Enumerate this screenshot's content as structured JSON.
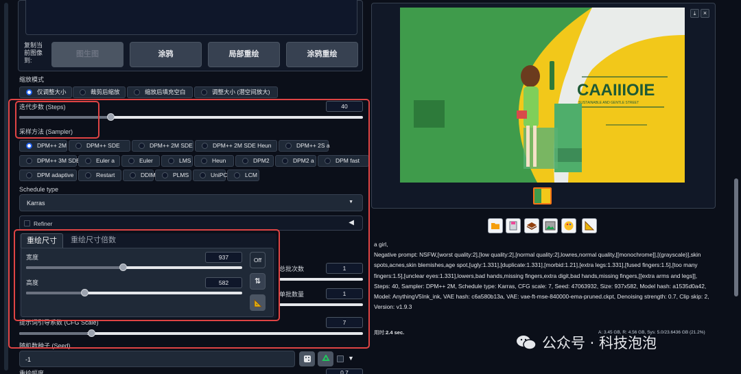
{
  "copy_to": {
    "label_lines": [
      "复制当",
      "前图像",
      "到:"
    ],
    "buttons": [
      "图生图",
      "涂鸦",
      "局部重绘",
      "涂鸦重绘"
    ]
  },
  "resize_mode": {
    "label": "缩放模式",
    "options": [
      "仅调整大小",
      "裁剪后缩放",
      "缩放后填充空白",
      "调整大小 (潜空间放大)"
    ],
    "selected": 0
  },
  "steps": {
    "label": "迭代步数 (Steps)",
    "value": "40",
    "min": 1,
    "max": 150,
    "raw": 40
  },
  "sampler": {
    "label": "采样方法 (Sampler)",
    "selected": "DPM++ 2M",
    "options": [
      "DPM++ 2M",
      "DPM++ SDE",
      "DPM++ 2M SDE",
      "DPM++ 2M SDE Heun",
      "DPM++ 2S a",
      "DPM++ 3M SDE",
      "Euler a",
      "Euler",
      "LMS",
      "Heun",
      "DPM2",
      "DPM2 a",
      "DPM fast",
      "DPM adaptive",
      "Restart",
      "DDIM",
      "PLMS",
      "UniPC",
      "LCM"
    ]
  },
  "schedule": {
    "label": "Schedule type",
    "value": "Karras"
  },
  "refiner": {
    "label": "Refiner",
    "arrow": "◀"
  },
  "resize_tabs": {
    "tabs": [
      "重绘尺寸",
      "重绘尺寸倍数"
    ],
    "active": 0
  },
  "width": {
    "label": "宽度",
    "value": "937",
    "fraction": 0.45
  },
  "height": {
    "label": "高度",
    "value": "582",
    "fraction": 0.27
  },
  "buttons_side": {
    "off": "Off",
    "swap": "⇅",
    "ruler": "📐"
  },
  "batch_count": {
    "label": "总批次数",
    "value": "1"
  },
  "batch_size": {
    "label": "单批数量",
    "value": "1"
  },
  "cfg": {
    "label": "提示词引导系数 (CFG Scale)",
    "value": "7",
    "fraction": 0.2
  },
  "seed": {
    "label": "随机数种子 (Seed)",
    "value": "-1"
  },
  "denoise": {
    "label": "重绘幅度",
    "value": "0.7"
  },
  "gallery": {
    "close": "×",
    "download": "⤓"
  },
  "poster": {
    "title": "CAAIIIOIE",
    "subtitle": "SUSTAINABLE AND GENTLE STREET"
  },
  "info": {
    "prompt": "a girl,",
    "negative": "Negative prompt: NSFW,[worst quality:2],[low quality:2],[normal quality:2],lowres,normal quality,[[monochrome]],[(grayscale)],skin spots,acnes,skin blemishes,age spot,[ugly:1.331],[duplicate:1.331],[morbid:1.21],[extra legs:1.331],[fused fingers:1.5],[too many fingers:1.5],[unclear eyes:1.331],lowers,bad hands,missing fingers,extra digit,bad hands,missing fingers,[[extra arms and legs]],",
    "params": "Steps: 40, Sampler: DPM++ 2M, Schedule type: Karras, CFG scale: 7, Seed: 47063932, Size: 937x582, Model hash: a1535d0a42, Model: AnythingV5Ink_ink, VAE hash: c6a580b13a, VAE: vae-ft-mse-840000-ema-pruned.ckpt, Denoising strength: 0.7, Clip skip: 2, Version: v1.9.3",
    "time_label": "用时:",
    "time_value": "2.4 sec.",
    "memory": "A: 3.45 GB, R: 4.56 GB, Sys: 5.0/23.6436 GB (21.2%)"
  },
  "watermark": "公众号 · 科技泡泡",
  "colors": {
    "accent": "#2563eb",
    "highlight": "#e04444",
    "poster_bg": "#f2c81a",
    "poster_green": "#3f9b4b"
  }
}
